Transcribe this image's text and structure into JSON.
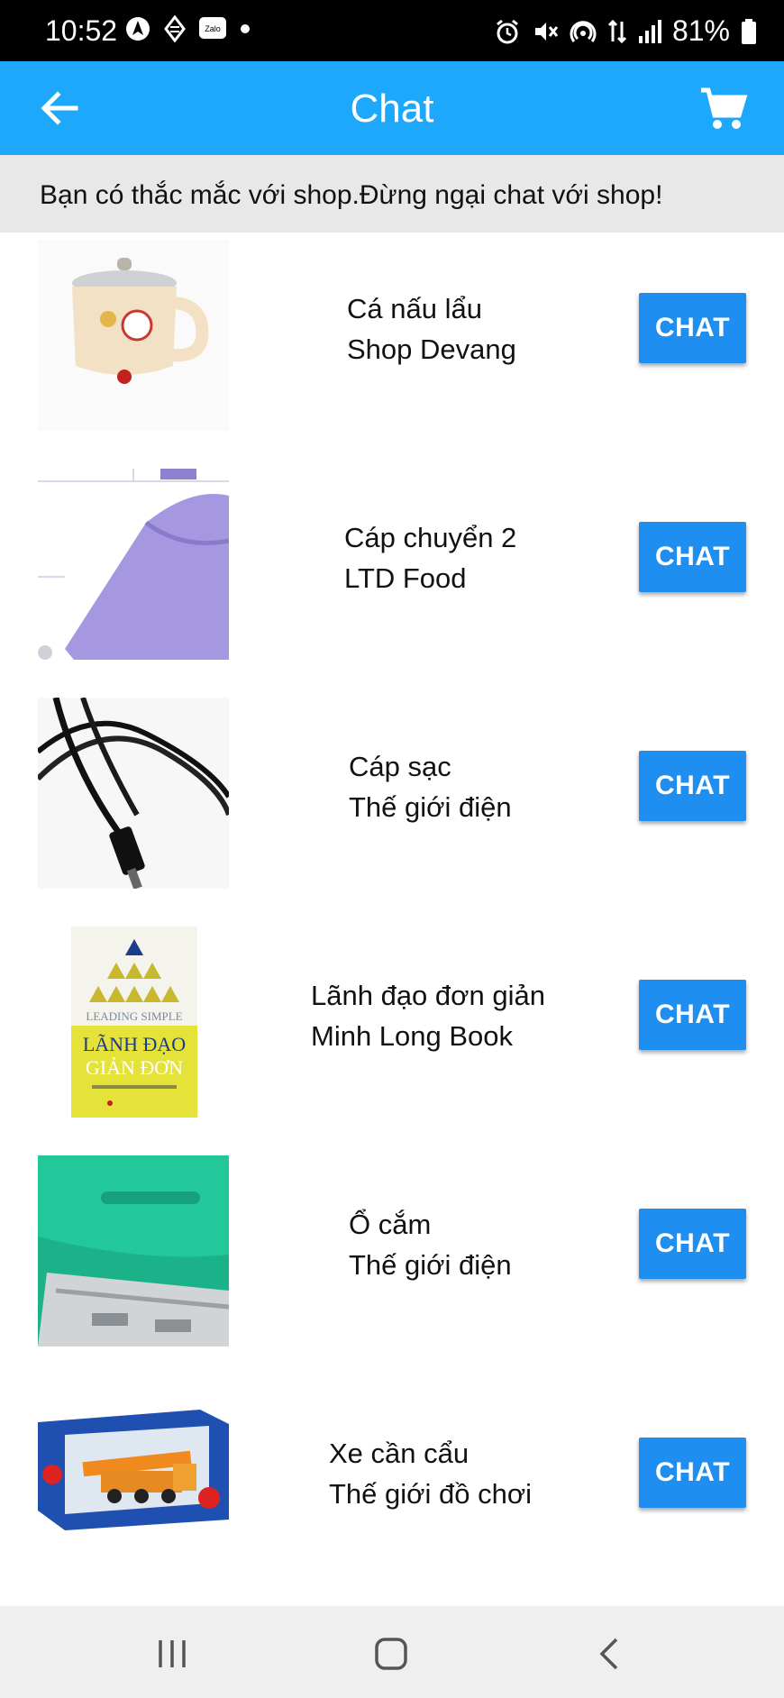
{
  "status_bar": {
    "time": "10:52",
    "battery": "81%",
    "left_icons": [
      "navigation-icon",
      "data-saver-icon",
      "zalo-icon",
      "dot-icon"
    ],
    "right_icons": [
      "alarm-icon",
      "mute-icon",
      "hotspot-icon",
      "data-icon",
      "signal-icon",
      "battery-icon"
    ]
  },
  "app_bar": {
    "title": "Chat",
    "back_icon": "arrow-left-icon",
    "cart_icon": "shopping-cart-icon",
    "color": "#1ea8fb"
  },
  "notice": {
    "text": "Bạn có thắc mắc với shop.Đừng ngại chat với shop!"
  },
  "chats": [
    {
      "product": "Cá nấu lẩu",
      "shop": "Shop Devang",
      "button": "CHAT",
      "image": "pot-image"
    },
    {
      "product": "Cáp chuyển 2",
      "shop": "LTD Food",
      "button": "CHAT",
      "image": "purple-adapter-image"
    },
    {
      "product": "Cáp sạc",
      "shop": "Thế giới điện",
      "button": "CHAT",
      "image": "black-cable-image"
    },
    {
      "product": "Lãnh đạo đơn giản",
      "shop": "Minh Long Book",
      "button": "CHAT",
      "image": "book-cover-image",
      "book_cover": {
        "top": "LEADING SIMPLE",
        "title1": "LÃNH ĐẠO",
        "title2": "GIẢN ĐƠN"
      }
    },
    {
      "product": "Ổ cắm",
      "shop": "Thế giới điện",
      "button": "CHAT",
      "image": "green-usb-image"
    },
    {
      "product": "Xe cần cẩu",
      "shop": "Thế giới đồ chơi",
      "button": "CHAT",
      "image": "toy-crane-image"
    }
  ],
  "accent_color": "#1e8ff0",
  "nav_bar": {
    "icons": [
      "recent-apps-icon",
      "home-icon",
      "back-icon"
    ]
  }
}
